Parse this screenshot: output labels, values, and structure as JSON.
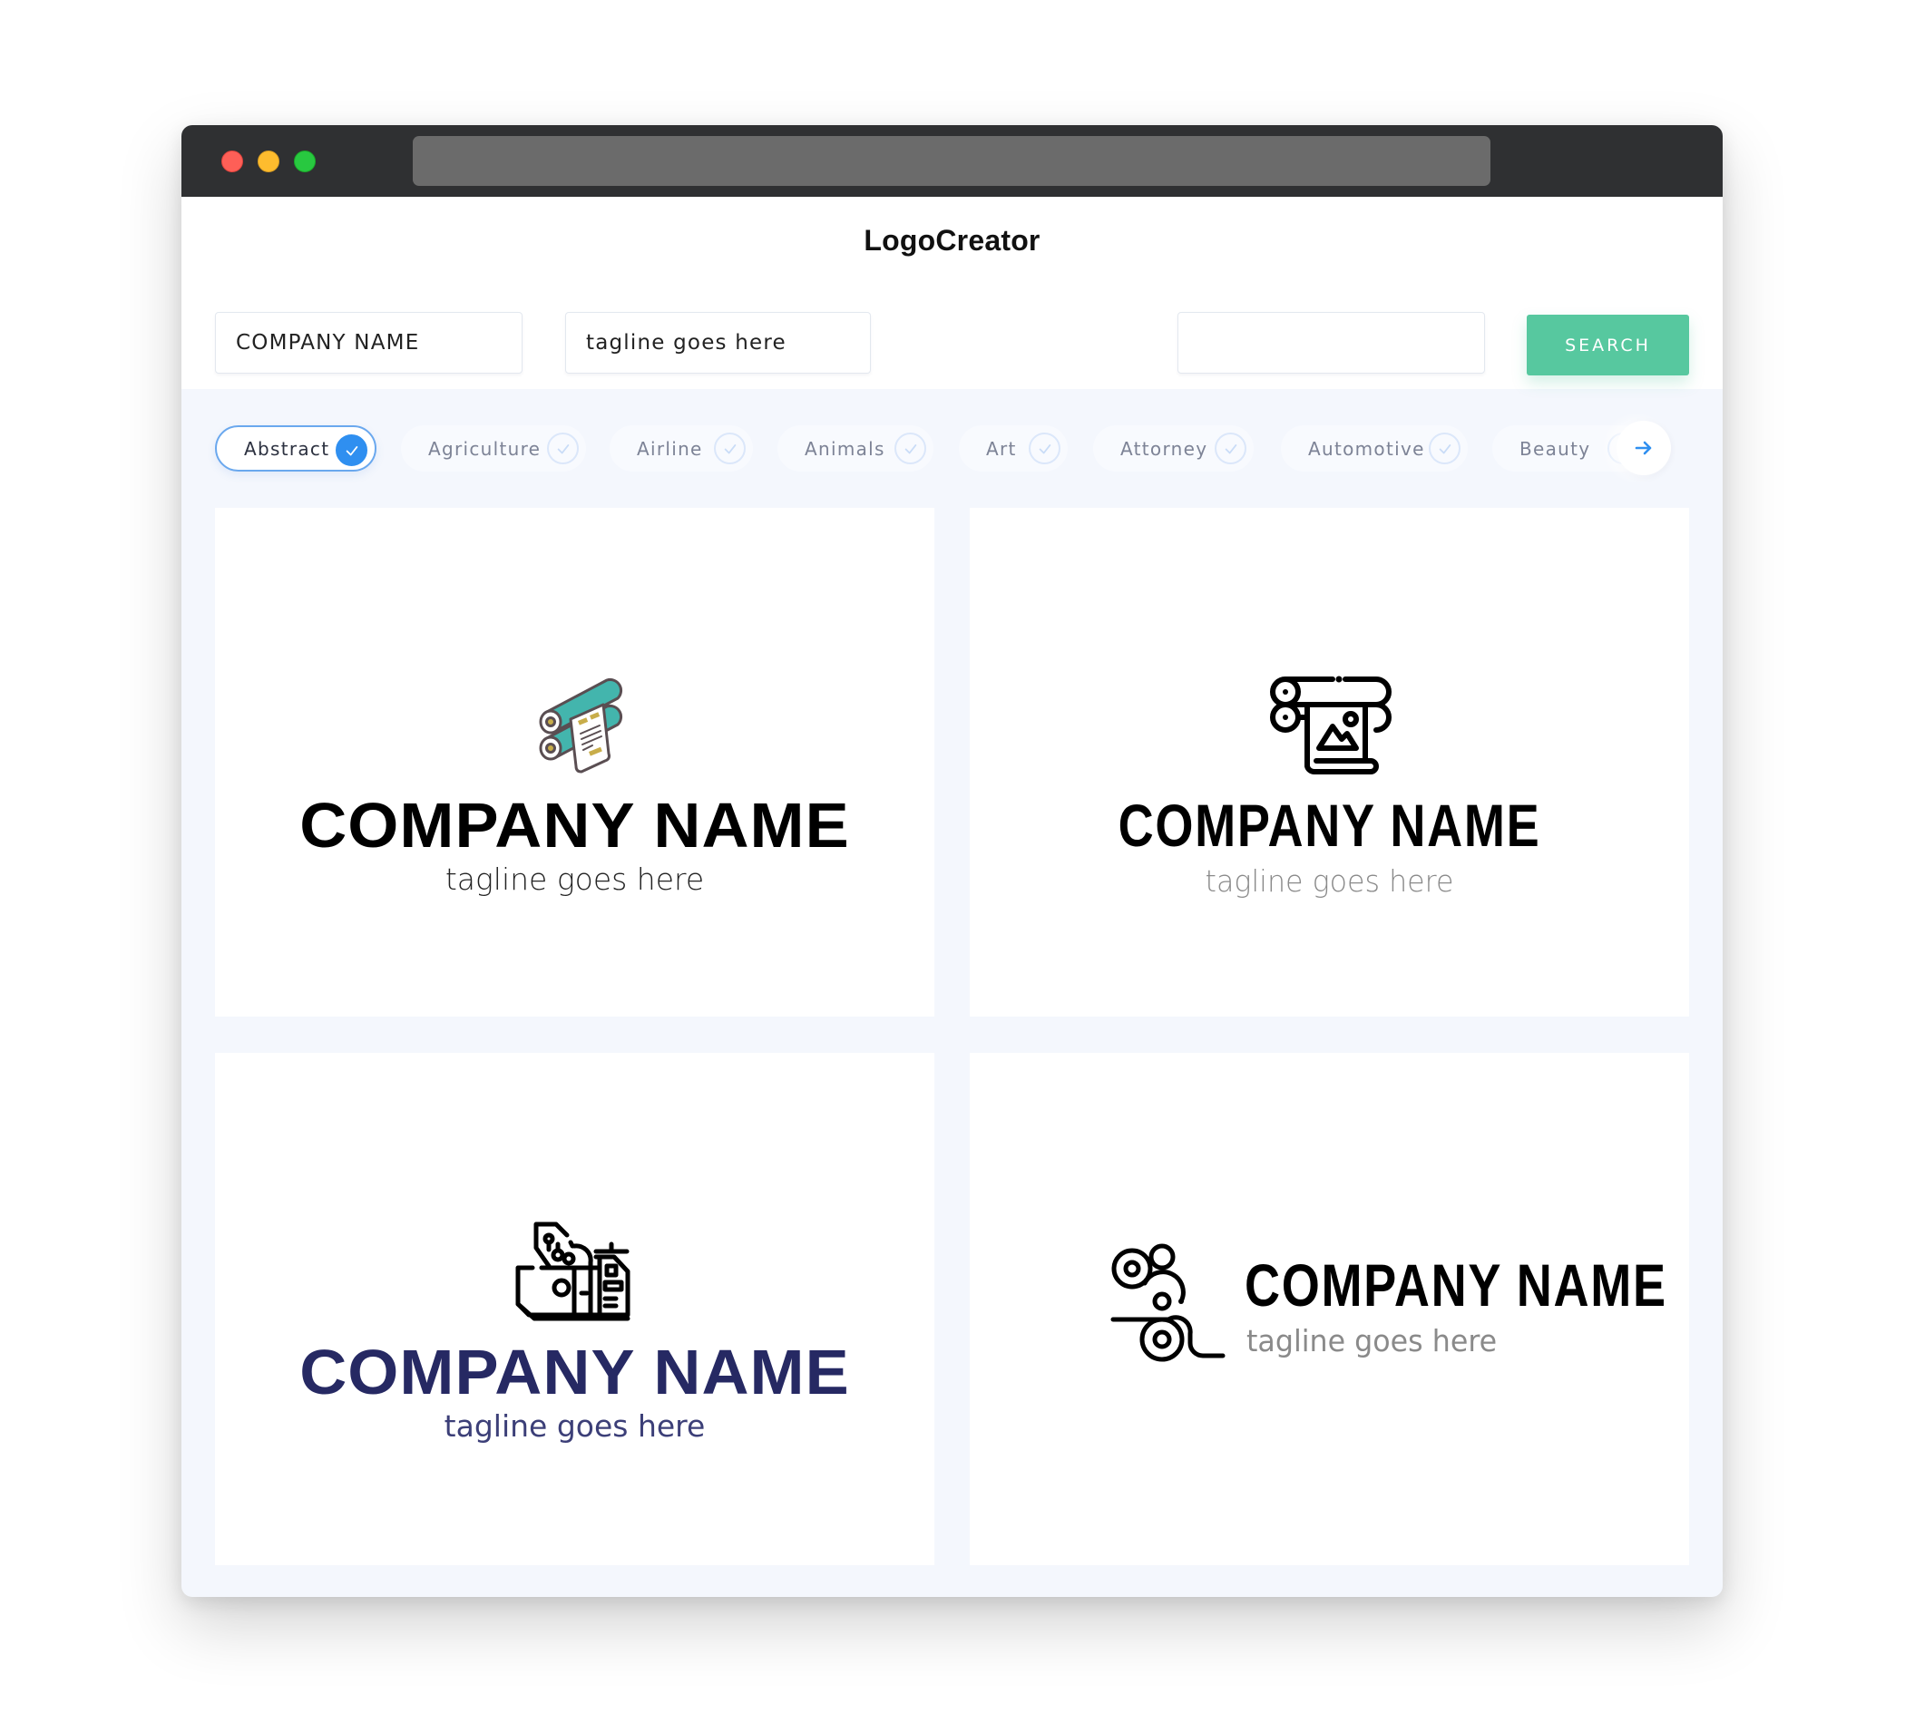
{
  "window": {
    "traffic_lights": [
      "close",
      "minimize",
      "maximize"
    ],
    "colors": {
      "close": "#fe5f57",
      "minimize": "#febc2e",
      "maximize": "#28c840"
    }
  },
  "header": {
    "title": "LogoCreator"
  },
  "search": {
    "company_name_value": "COMPANY NAME",
    "tagline_value": "tagline goes here",
    "keyword_value": "",
    "button_label": "SEARCH",
    "button_color": "#57c89f"
  },
  "categories": {
    "items": [
      {
        "label": "Abstract",
        "selected": true
      },
      {
        "label": "Agriculture",
        "selected": false
      },
      {
        "label": "Airline",
        "selected": false
      },
      {
        "label": "Animals",
        "selected": false
      },
      {
        "label": "Art",
        "selected": false
      },
      {
        "label": "Attorney",
        "selected": false
      },
      {
        "label": "Automotive",
        "selected": false
      },
      {
        "label": "Beauty",
        "selected": false
      }
    ],
    "next_icon": "arrow-right-icon",
    "accent_color": "#2f8ff0"
  },
  "logos": [
    {
      "icon": "printing-rollers-color-icon",
      "company_name": "COMPANY NAME",
      "tagline": "tagline goes here",
      "name_color": "#000000",
      "tagline_color": "#222222"
    },
    {
      "icon": "poster-printer-outline-icon",
      "company_name": "COMPANY NAME",
      "tagline": "tagline goes here",
      "name_color": "#000000",
      "tagline_color": "#8a8a8a"
    },
    {
      "icon": "printing-press-machine-icon",
      "company_name": "COMPANY NAME",
      "tagline": "tagline goes here",
      "name_color": "#262963",
      "tagline_color": "#3c3f78"
    },
    {
      "icon": "paper-rollers-icon",
      "company_name": "COMPANY NAME",
      "tagline": "tagline goes here",
      "name_color": "#000000",
      "tagline_color": "#8a8a8a"
    }
  ]
}
